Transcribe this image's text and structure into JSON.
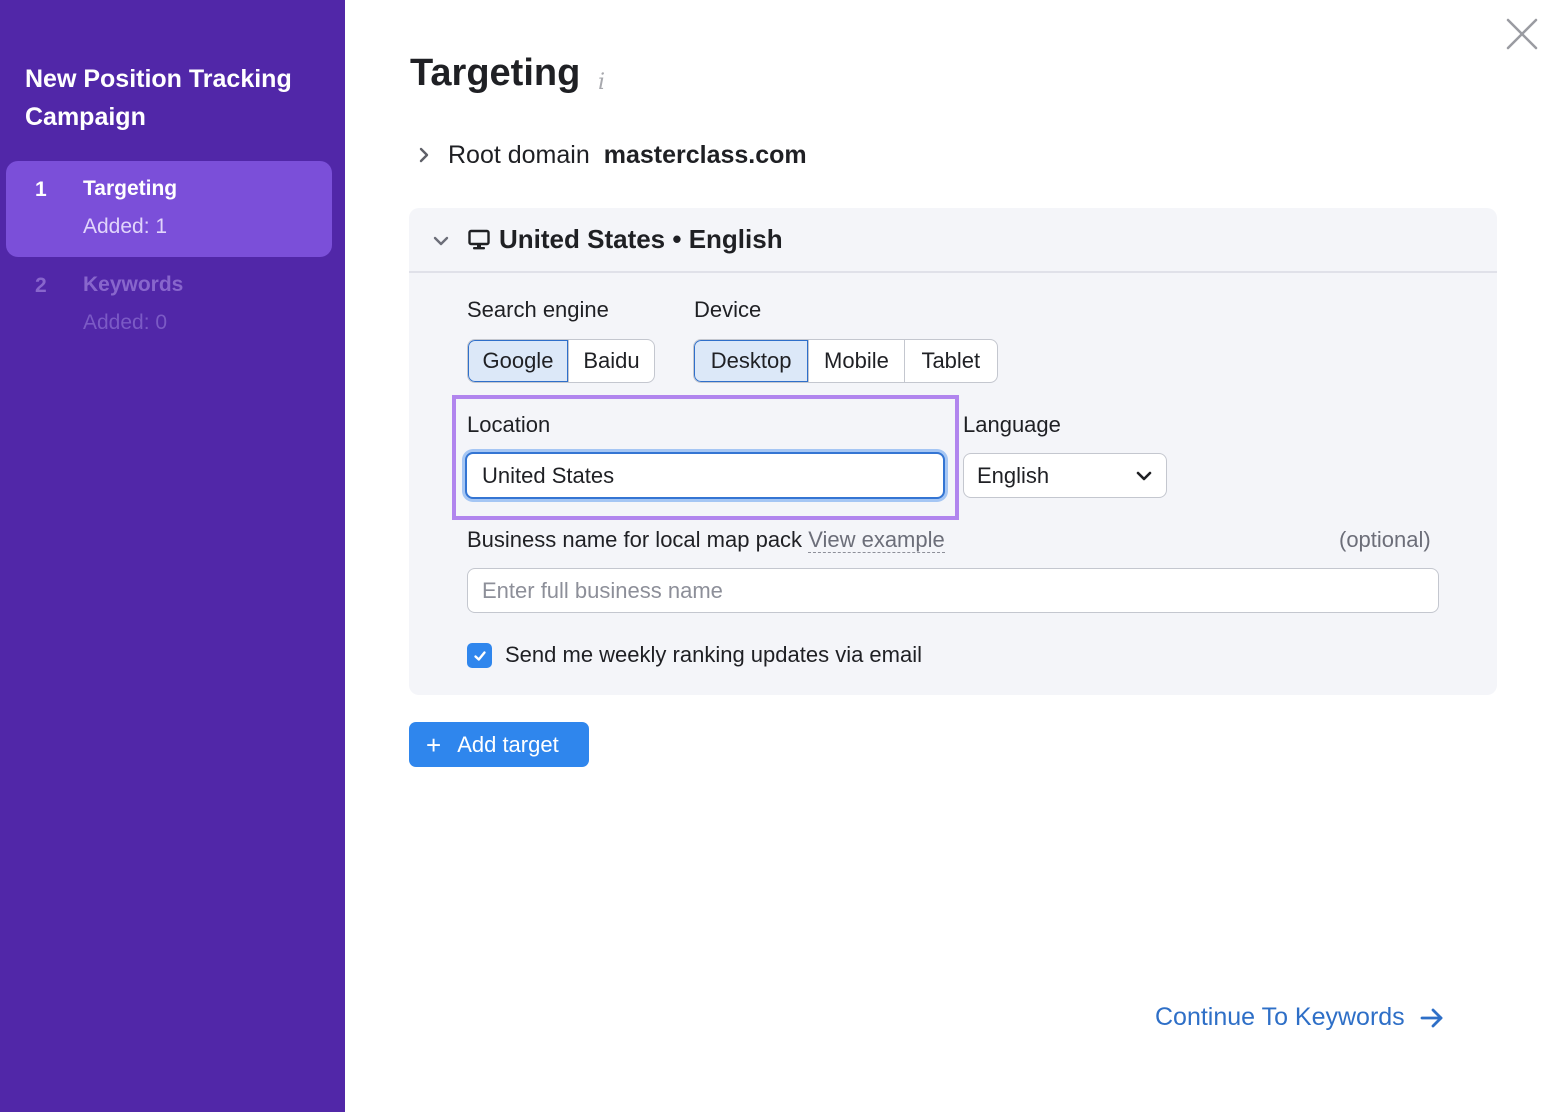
{
  "sidebar": {
    "title": "New Position Tracking Campaign",
    "steps": [
      {
        "number": "1",
        "label": "Targeting",
        "sub": "Added: 1",
        "active": true
      },
      {
        "number": "2",
        "label": "Keywords",
        "sub": "Added: 0",
        "active": false
      }
    ]
  },
  "header": {
    "title": "Targeting",
    "info_icon": "i",
    "root_domain_label": "Root domain",
    "root_domain_value": "masterclass.com"
  },
  "target": {
    "title": "United States • English",
    "device_icon": "monitor-icon",
    "search_engine": {
      "label": "Search engine",
      "options": [
        "Google",
        "Baidu"
      ],
      "selected": "Google"
    },
    "device": {
      "label": "Device",
      "options": [
        "Desktop",
        "Mobile",
        "Tablet"
      ],
      "selected": "Desktop"
    },
    "location": {
      "label": "Location",
      "value": "United States"
    },
    "language": {
      "label": "Language",
      "value": "English"
    },
    "business": {
      "label": "Business name for local map pack",
      "link": "View example",
      "optional": "(optional)",
      "placeholder": "Enter full business name",
      "value": ""
    },
    "weekly_updates": {
      "label": "Send me weekly ranking updates via email",
      "checked": true
    }
  },
  "actions": {
    "add_target": "Add target",
    "continue": "Continue To Keywords"
  },
  "colors": {
    "sidebar_bg": "#5127a8",
    "active_step_bg": "#7b4fd9",
    "primary_blue": "#2f86ed",
    "link_blue": "#2e6fc7",
    "highlight_purple": "#b185ee"
  }
}
